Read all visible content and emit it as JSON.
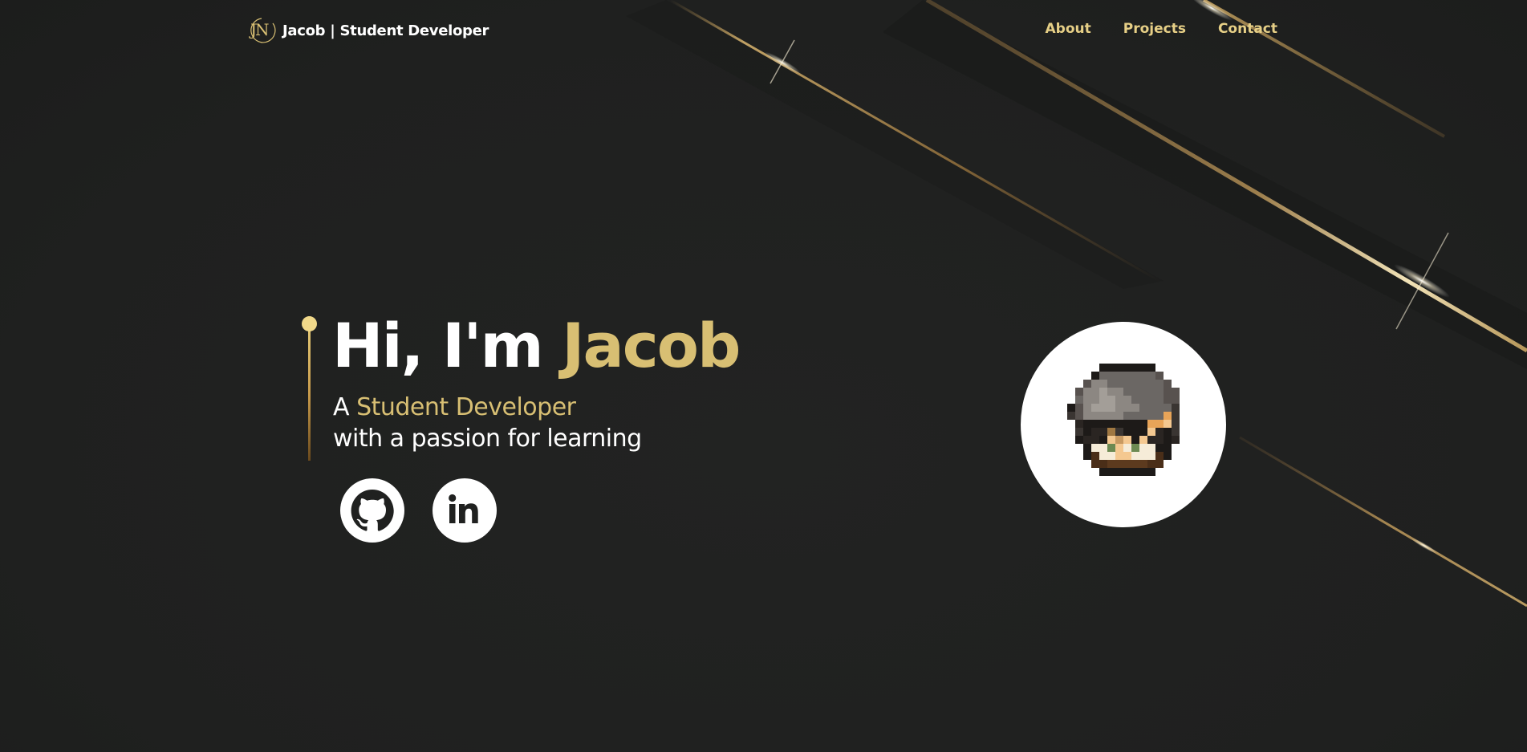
{
  "header": {
    "logo_text": "JN",
    "brand": "Jacob | Student Developer",
    "nav": [
      "About",
      "Projects",
      "Contact"
    ]
  },
  "hero": {
    "greeting": "Hi, I'm ",
    "name": "Jacob",
    "subtitle_prefix": "A ",
    "role": "Student Developer",
    "tagline": "with a passion for learning"
  },
  "social": {
    "github_icon": "github-icon",
    "linkedin_icon": "linkedin-icon"
  },
  "colors": {
    "background": "#202120",
    "accent_gold": "#d8bf73",
    "nav_gold": "#e6cf86",
    "text": "#ffffff"
  }
}
